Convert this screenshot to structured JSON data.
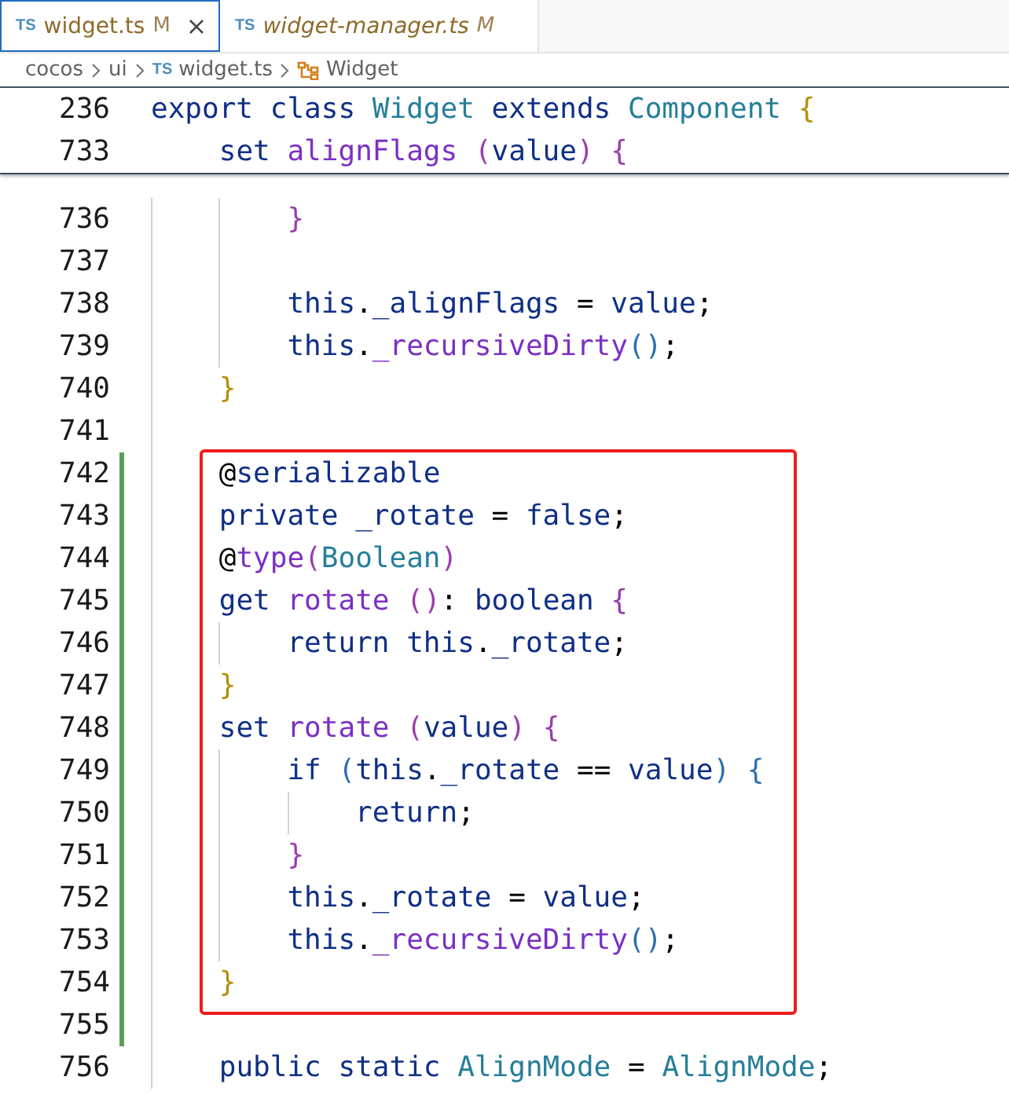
{
  "tabs": [
    {
      "icon_text": "TS",
      "label": "widget.ts",
      "badge": "M",
      "selected": true,
      "preview": false
    },
    {
      "icon_text": "TS",
      "label": "widget-manager.ts",
      "badge": "M",
      "selected": false,
      "preview": true
    }
  ],
  "breadcrumbs": [
    {
      "kind": "folder",
      "label": "cocos"
    },
    {
      "kind": "folder",
      "label": "ui"
    },
    {
      "kind": "file",
      "icon_text": "TS",
      "label": "widget.ts"
    },
    {
      "kind": "symbol",
      "label": "Widget"
    }
  ],
  "sticky_lines": [
    {
      "number": "236",
      "code": "export class Widget extends Component {"
    },
    {
      "number": "733",
      "code": "    set alignFlags (value) {"
    }
  ],
  "lines_before": [
    {
      "number": "736",
      "changed": false,
      "code": "        }"
    },
    {
      "number": "737",
      "changed": false
    },
    {
      "number": "738",
      "changed": false,
      "code": "        this._alignFlags = value;"
    },
    {
      "number": "739",
      "changed": false,
      "code": "        this._recursiveDirty();"
    },
    {
      "number": "740",
      "changed": false,
      "code": "    }"
    },
    {
      "number": "741",
      "changed": false
    }
  ],
  "highlighted_lines": [
    {
      "number": "742",
      "changed": true,
      "code": "    @serializable"
    },
    {
      "number": "743",
      "changed": true,
      "code": "    private _rotate = false;"
    },
    {
      "number": "744",
      "changed": true,
      "code": "    @type(Boolean)"
    },
    {
      "number": "745",
      "changed": true,
      "code": "    get rotate (): boolean {"
    },
    {
      "number": "746",
      "changed": true,
      "code": "        return this._rotate;"
    },
    {
      "number": "747",
      "changed": true,
      "code": "    }"
    },
    {
      "number": "748",
      "changed": true,
      "code": "    set rotate (value) {"
    },
    {
      "number": "749",
      "changed": true,
      "code": "        if (this._rotate == value) {"
    },
    {
      "number": "750",
      "changed": true,
      "code": "            return;"
    },
    {
      "number": "751",
      "changed": true,
      "code": "        }"
    },
    {
      "number": "752",
      "changed": true,
      "code": "        this._rotate = value;"
    },
    {
      "number": "753",
      "changed": true,
      "code": "        this._recursiveDirty();"
    },
    {
      "number": "754",
      "changed": true,
      "code": "    }"
    }
  ],
  "lines_after": [
    {
      "number": "755",
      "changed": true
    },
    {
      "number": "756",
      "changed": false,
      "code": "    public static AlignMode = AlignMode;"
    }
  ]
}
